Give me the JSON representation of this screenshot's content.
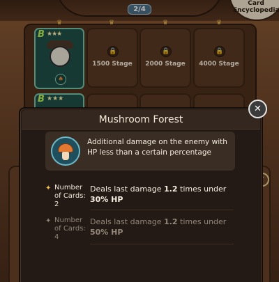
{
  "header": {
    "card_count": "2/4",
    "encyclopedia_label": "Card Encyclopedia"
  },
  "grid": {
    "card": {
      "grade": "B",
      "stars": "★★★"
    },
    "slots": [
      {
        "label": "1500 Stage"
      },
      {
        "label": "2000 Stage"
      },
      {
        "label": "4000 Stage"
      }
    ],
    "row2_card": {
      "grade": "B",
      "stars": "★★★"
    }
  },
  "popup": {
    "title": "Mushroom Forest",
    "description": "Additional damage on the enemy with HP less than a certain percentage",
    "effects": [
      {
        "cards_label": "Number of Cards: 2",
        "text_prefix": "Deals last damage ",
        "multiplier": "1.2",
        "text_mid": " times under ",
        "threshold": "30% HP",
        "active": true
      },
      {
        "cards_label": "Number of Cards: 4",
        "text_prefix": "Deals last damage ",
        "multiplier": "1.2",
        "text_mid": " times under ",
        "threshold": "50% HP",
        "active": false
      }
    ]
  },
  "colors": {
    "accent_gold": "#f5c04a",
    "card_frame": "#77c1a8",
    "popup_bg": "#231a15",
    "mushroom_cap": "#e27933"
  },
  "icons": {
    "close": "close-icon",
    "lock": "lock-icon",
    "crown": "crown-icon",
    "mushroom": "mushroom-icon",
    "star": "star-icon"
  }
}
